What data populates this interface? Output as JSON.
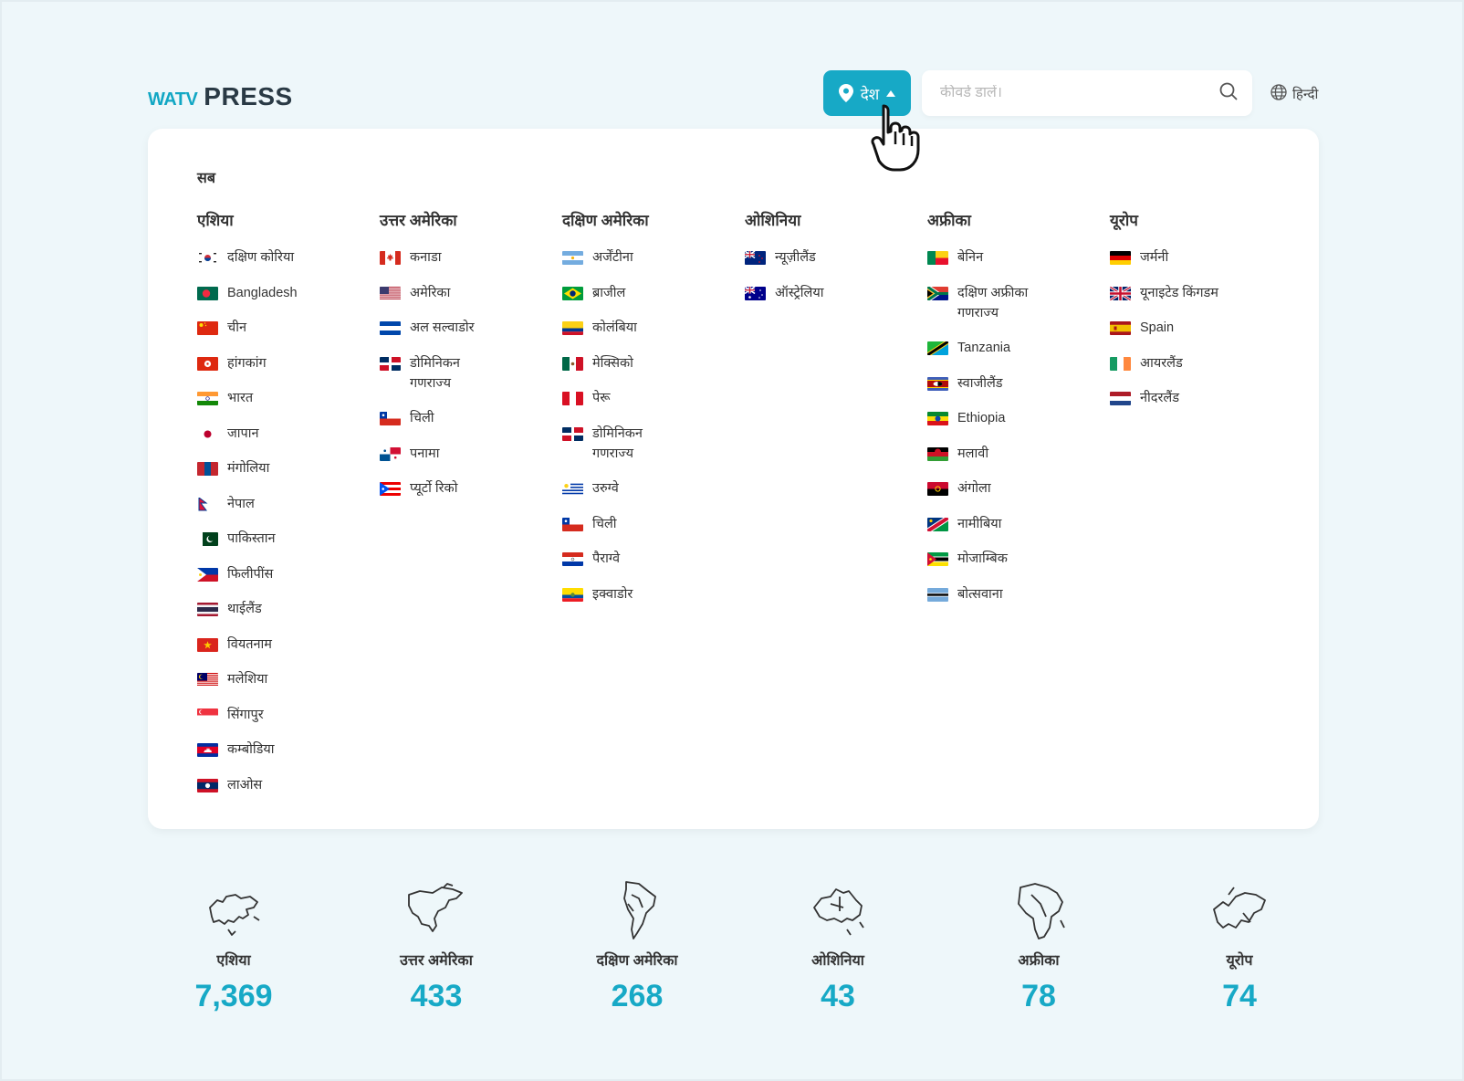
{
  "header": {
    "logo_brand": "WATV",
    "logo_press": "PRESS",
    "country_button_label": "देश",
    "search_placeholder": "कीवर्ड डालें।",
    "language_label": "हिन्दी"
  },
  "panel": {
    "all_label": "सब",
    "columns": [
      {
        "title": "एशिया",
        "items": [
          {
            "label": "दक्षिण कोरिया",
            "flag": "kr"
          },
          {
            "label": "Bangladesh",
            "flag": "bd"
          },
          {
            "label": "चीन",
            "flag": "cn"
          },
          {
            "label": "हांगकांग",
            "flag": "hk"
          },
          {
            "label": "भारत",
            "flag": "in"
          },
          {
            "label": "जापान",
            "flag": "jp"
          },
          {
            "label": "मंगोलिया",
            "flag": "mn"
          },
          {
            "label": "नेपाल",
            "flag": "np"
          },
          {
            "label": "पाकिस्तान",
            "flag": "pk"
          },
          {
            "label": "फिलीपींस",
            "flag": "ph"
          },
          {
            "label": "थाईलैंड",
            "flag": "th"
          },
          {
            "label": "वियतनाम",
            "flag": "vn"
          },
          {
            "label": "मलेशिया",
            "flag": "my"
          },
          {
            "label": "सिंगापुर",
            "flag": "sg"
          },
          {
            "label": "कम्बोडिया",
            "flag": "kh"
          },
          {
            "label": "लाओस",
            "flag": "la"
          }
        ]
      },
      {
        "title": "उत्तर अमेरिका",
        "items": [
          {
            "label": "कनाडा",
            "flag": "ca"
          },
          {
            "label": "अमेरिका",
            "flag": "us"
          },
          {
            "label": "अल सल्वाडोर",
            "flag": "sv"
          },
          {
            "label": "डोमिनिकन गणराज्य",
            "flag": "do"
          },
          {
            "label": "चिली",
            "flag": "cl"
          },
          {
            "label": "पनामा",
            "flag": "pa"
          },
          {
            "label": "प्यूर्टो रिको",
            "flag": "pr"
          }
        ]
      },
      {
        "title": "दक्षिण अमेरिका",
        "items": [
          {
            "label": "अर्जेंटीना",
            "flag": "ar"
          },
          {
            "label": "ब्राजील",
            "flag": "br"
          },
          {
            "label": "कोलंबिया",
            "flag": "co"
          },
          {
            "label": "मेक्सिको",
            "flag": "mx"
          },
          {
            "label": "पेरू",
            "flag": "pe"
          },
          {
            "label": "डोमिनिकन गणराज्य",
            "flag": "do"
          },
          {
            "label": "उरुग्वे",
            "flag": "uy"
          },
          {
            "label": "चिली",
            "flag": "cl"
          },
          {
            "label": "पैराग्वे",
            "flag": "py"
          },
          {
            "label": "इक्वाडोर",
            "flag": "ec"
          }
        ]
      },
      {
        "title": "ओशिनिया",
        "items": [
          {
            "label": "न्यूज़ीलैंड",
            "flag": "nz"
          },
          {
            "label": "ऑस्ट्रेलिया",
            "flag": "au"
          }
        ]
      },
      {
        "title": "अफ्रीका",
        "items": [
          {
            "label": "बेनिन",
            "flag": "bj"
          },
          {
            "label": "दक्षिण अफ्रीका गणराज्य",
            "flag": "za"
          },
          {
            "label": "Tanzania",
            "flag": "tz"
          },
          {
            "label": "स्वाजीलैंड",
            "flag": "sz"
          },
          {
            "label": "Ethiopia",
            "flag": "et"
          },
          {
            "label": "मलावी",
            "flag": "mw"
          },
          {
            "label": "अंगोला",
            "flag": "ao"
          },
          {
            "label": "नामीबिया",
            "flag": "na"
          },
          {
            "label": "मोजाम्बिक",
            "flag": "mz"
          },
          {
            "label": "बोत्सवाना",
            "flag": "bw"
          }
        ]
      },
      {
        "title": "यूरोप",
        "items": [
          {
            "label": "जर्मनी",
            "flag": "de"
          },
          {
            "label": "यूनाइटेड किंगडम",
            "flag": "gb"
          },
          {
            "label": "Spain",
            "flag": "es"
          },
          {
            "label": "आयरलैंड",
            "flag": "ie"
          },
          {
            "label": "नीदरलैंड",
            "flag": "nl"
          }
        ]
      }
    ]
  },
  "stats": [
    {
      "name": "एशिया",
      "count": "7,369",
      "icon": "asia-map-icon"
    },
    {
      "name": "उत्तर अमेरिका",
      "count": "433",
      "icon": "north-america-map-icon"
    },
    {
      "name": "दक्षिण अमेरिका",
      "count": "268",
      "icon": "south-america-map-icon"
    },
    {
      "name": "ओशिनिया",
      "count": "43",
      "icon": "oceania-map-icon"
    },
    {
      "name": "अफ्रीका",
      "count": "78",
      "icon": "africa-map-icon"
    },
    {
      "name": "यूरोप",
      "count": "74",
      "icon": "europe-map-icon"
    }
  ],
  "colors": {
    "accent": "#17a9c6",
    "background": "#eef7fa",
    "panel": "#ffffff",
    "text": "#333333"
  }
}
